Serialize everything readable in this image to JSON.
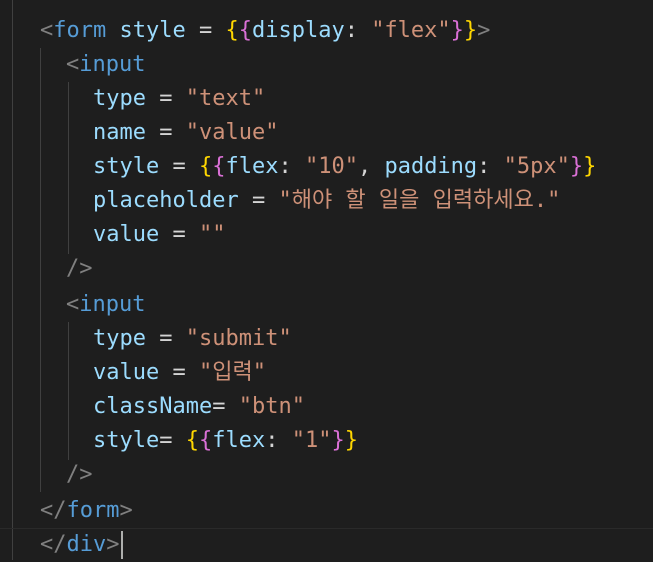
{
  "editor": {
    "lines": [
      {
        "tokens": [
          [
            "tag-bracket",
            "<"
          ],
          [
            "tag",
            "form"
          ],
          [
            "op",
            " "
          ],
          [
            "attr",
            "style"
          ],
          [
            "op",
            " = "
          ],
          [
            "brace1",
            "{"
          ],
          [
            "brace2",
            "{"
          ],
          [
            "attr",
            "display"
          ],
          [
            "op",
            ": "
          ],
          [
            "str",
            "\"flex\""
          ],
          [
            "brace2",
            "}"
          ],
          [
            "brace1",
            "}"
          ],
          [
            "tag-bracket",
            ">"
          ]
        ]
      },
      {
        "tokens": [
          [
            "tag-bracket",
            "<"
          ],
          [
            "tag",
            "input"
          ]
        ]
      },
      {
        "tokens": [
          [
            "attr",
            "type"
          ],
          [
            "op",
            " = "
          ],
          [
            "str",
            "\"text\""
          ]
        ]
      },
      {
        "tokens": [
          [
            "attr",
            "name"
          ],
          [
            "op",
            " = "
          ],
          [
            "str",
            "\"value\""
          ]
        ]
      },
      {
        "tokens": [
          [
            "attr",
            "style"
          ],
          [
            "op",
            " = "
          ],
          [
            "brace1",
            "{"
          ],
          [
            "brace2",
            "{"
          ],
          [
            "attr",
            "flex"
          ],
          [
            "op",
            ": "
          ],
          [
            "str",
            "\"10\""
          ],
          [
            "op",
            ", "
          ],
          [
            "attr",
            "padding"
          ],
          [
            "op",
            ": "
          ],
          [
            "str",
            "\"5px\""
          ],
          [
            "brace2",
            "}"
          ],
          [
            "brace1",
            "}"
          ]
        ]
      },
      {
        "tokens": [
          [
            "attr",
            "placeholder"
          ],
          [
            "op",
            " = "
          ],
          [
            "str",
            "\"해야 할 일을 입력하세요.\""
          ]
        ]
      },
      {
        "tokens": [
          [
            "attr",
            "value"
          ],
          [
            "op",
            " = "
          ],
          [
            "str",
            "\"\""
          ]
        ]
      },
      {
        "tokens": [
          [
            "tag-bracket",
            "/>"
          ]
        ]
      },
      {
        "tokens": [
          [
            "tag-bracket",
            "<"
          ],
          [
            "tag",
            "input"
          ]
        ]
      },
      {
        "tokens": [
          [
            "attr",
            "type"
          ],
          [
            "op",
            " = "
          ],
          [
            "str",
            "\"submit\""
          ]
        ]
      },
      {
        "tokens": [
          [
            "attr",
            "value"
          ],
          [
            "op",
            " = "
          ],
          [
            "str",
            "\"입력\""
          ]
        ]
      },
      {
        "tokens": [
          [
            "attr",
            "className"
          ],
          [
            "op",
            "= "
          ],
          [
            "str",
            "\"btn\""
          ]
        ]
      },
      {
        "tokens": [
          [
            "attr",
            "style"
          ],
          [
            "op",
            "= "
          ],
          [
            "brace1",
            "{"
          ],
          [
            "brace2",
            "{"
          ],
          [
            "attr",
            "flex"
          ],
          [
            "op",
            ": "
          ],
          [
            "str",
            "\"1\""
          ],
          [
            "brace2",
            "}"
          ],
          [
            "brace1",
            "}"
          ]
        ]
      },
      {
        "tokens": [
          [
            "tag-bracket",
            "/>"
          ]
        ]
      },
      {
        "tokens": [
          [
            "tag-bracket",
            "</"
          ],
          [
            "tag",
            "form"
          ],
          [
            "tag-bracket",
            ">"
          ]
        ]
      },
      {
        "tokens": [
          [
            "tag-bracket",
            "</"
          ],
          [
            "tag",
            "div"
          ],
          [
            "tag-bracket",
            ">"
          ]
        ]
      }
    ]
  }
}
